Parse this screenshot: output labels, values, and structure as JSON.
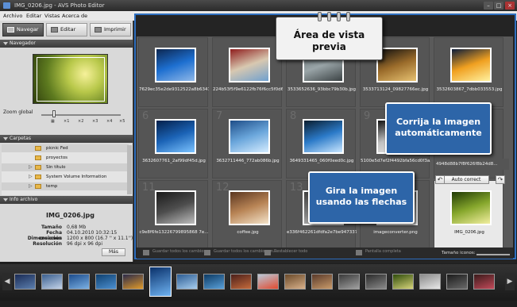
{
  "window": {
    "title": "IMG_0206.jpg - AVS Photo Editor"
  },
  "menu": [
    "Archivo",
    "Editar",
    "Vistas",
    "Acerca de"
  ],
  "tabs": [
    {
      "label": "Navegar",
      "active": true,
      "icon": "navigate-icon"
    },
    {
      "label": "Editar",
      "active": false,
      "icon": "edit-icon"
    },
    {
      "label": "Imprimir",
      "active": false,
      "icon": "print-icon"
    }
  ],
  "navigator": {
    "title": "Navegador",
    "zoom_label": "Zoom global",
    "zoom_marks": [
      "×1",
      "×2",
      "×3",
      "×4",
      "×5"
    ]
  },
  "folders": {
    "title": "Carpetas",
    "items": [
      {
        "name": "picnic Fed",
        "expandable": false
      },
      {
        "name": "proyectos",
        "expandable": false
      },
      {
        "name": "Sin título",
        "expandable": true
      },
      {
        "name": "System Volume Information",
        "expandable": true
      },
      {
        "name": "temp",
        "expandable": true
      }
    ]
  },
  "info": {
    "title": "Info archivo",
    "filename": "IMG_0206.jpg",
    "rows": [
      {
        "key": "Tamaño",
        "value": "0,68 Mb"
      },
      {
        "key": "Fecha creación",
        "value": "04.10.2010 10:32:15"
      },
      {
        "key": "Dimensiones",
        "value": "1200 x 800 (16.7 '' x 11.1'')"
      },
      {
        "key": "Resolución",
        "value": "96 dpi x 96 dpi"
      }
    ],
    "more_button": "Más"
  },
  "grid": {
    "cells": [
      {
        "num": "",
        "caption": "7629ec35e2de9312522a8b6341b...",
        "colors": [
          "#0d2750",
          "#1d6fd0",
          "#8fb8e8"
        ],
        "selected": false
      },
      {
        "num": "",
        "caption": "224b53f5f9e6122fb76f6cc5f0d6...",
        "colors": [
          "#8f1d1d",
          "#d8c8b0",
          "#6fa0cf"
        ],
        "selected": false
      },
      {
        "num": "",
        "caption": "3533652636_93bbc79b30b.jpg",
        "colors": [
          "#5f6a6d",
          "#9aa5a8",
          "#3b4244"
        ],
        "selected": false
      },
      {
        "num": "",
        "caption": "3533713124_09827766ec.jpg",
        "colors": [
          "#0f0f0f",
          "#9a6b2a",
          "#e7c272"
        ],
        "selected": false
      },
      {
        "num": "",
        "caption": "3532603867_7dbb033553.jpg",
        "colors": [
          "#0a1b3a",
          "#f0a020",
          "#fff2a0"
        ],
        "selected": false
      },
      {
        "num": "6",
        "caption": "3632607761_2af99df45d.jpg",
        "colors": [
          "#04204a",
          "#1b63b6",
          "#7cc3ff"
        ],
        "selected": false
      },
      {
        "num": "7",
        "caption": "3632711446_772ab086b.jpg",
        "colors": [
          "#1e4d88",
          "#6aa6db",
          "#d4ecff"
        ],
        "selected": false
      },
      {
        "num": "8",
        "caption": "3649331465_060f0eed0c.jpg",
        "colors": [
          "#0a1d2e",
          "#2b7ac8",
          "#c9e6ff"
        ],
        "selected": false
      },
      {
        "num": "9",
        "caption": "5100e5d7ef2f4492bfa56cd0f3a...",
        "colors": [
          "#111",
          "#c0c0c0",
          "#f0f0f0"
        ],
        "selected": false
      },
      {
        "num": "10",
        "caption": "4948d88b7f8f626f8b24d8...",
        "colors": [
          "#2b2b2b",
          "#bdbdbd",
          "#efefef"
        ],
        "selected": false
      },
      {
        "num": "11",
        "caption": "c9e8f6fe13226799895868 7e...",
        "colors": [
          "#1a1a1a",
          "#4d4d4d",
          "#bdbdbd"
        ],
        "selected": false
      },
      {
        "num": "12",
        "caption": "coffee.jpg",
        "colors": [
          "#5a3620",
          "#b88455",
          "#f4e3c9"
        ],
        "selected": false
      },
      {
        "num": "13",
        "caption": "e336f462261dfdfa2e7be9473379...",
        "colors": [
          "#404040",
          "#808080",
          "#cfcfcf"
        ],
        "selected": false
      },
      {
        "num": "14",
        "caption": "imageconverter.png",
        "colors": [
          "#3b3b3b",
          "#8a8a8a",
          "#d8d8d8"
        ],
        "selected": false
      },
      {
        "num": "",
        "caption": "IMG_0206.jpg",
        "colors": [
          "#203a05",
          "#86a72c",
          "#f2ef9f"
        ],
        "selected": true
      }
    ]
  },
  "bottom_tools": [
    {
      "label": "Guardar todos los cambios",
      "icon": "save-all-icon"
    },
    {
      "label": "Guardar todos los cambios en...",
      "icon": "save-as-icon"
    },
    {
      "label": "Restablecer todo",
      "icon": "reset-icon"
    },
    {
      "label": "Pantalla completa",
      "icon": "fullscreen-icon"
    }
  ],
  "thumb_size_label": "Tamaño iconos:",
  "actions": {
    "auto_correct": "Auto correct"
  },
  "callouts": {
    "preview_area": "Área de vista previa",
    "auto_correct": "Corrija la imagen automáticamente",
    "rotate": "Gira la imagen usando las flechas"
  },
  "filmstrip": {
    "thumbs": [
      [
        "#1a2b55",
        "#5c7fae"
      ],
      [
        "#3a5f8f",
        "#c3d2e8"
      ],
      [
        "#1c4c8c",
        "#7bb0e3"
      ],
      [
        "#0e4070",
        "#4d90d0"
      ],
      [
        "#2a2a4a",
        "#e09a2a"
      ],
      [
        "#09306a",
        "#6fb3f2"
      ],
      [
        "#2c5d94",
        "#a7cdee"
      ],
      [
        "#0c3a63",
        "#5aa0d9"
      ],
      [
        "#4b1f1a",
        "#c56b3c"
      ],
      [
        "#b8c8d8",
        "#e24a2f"
      ],
      [
        "#6a4a2a",
        "#d8b08a"
      ],
      [
        "#5a3a2a",
        "#c89a6a"
      ],
      [
        "#3a3a3a",
        "#a0a0a0"
      ],
      [
        "#2a2a2a",
        "#8a8a8a"
      ],
      [
        "#2f4b0b",
        "#d6d47a"
      ],
      [
        "#8a8a8a",
        "#e8e8e8"
      ],
      [
        "#1a1a1a",
        "#6a6a6a"
      ],
      [
        "#3a1a1a",
        "#c24a5a"
      ]
    ],
    "active_index": 5
  }
}
